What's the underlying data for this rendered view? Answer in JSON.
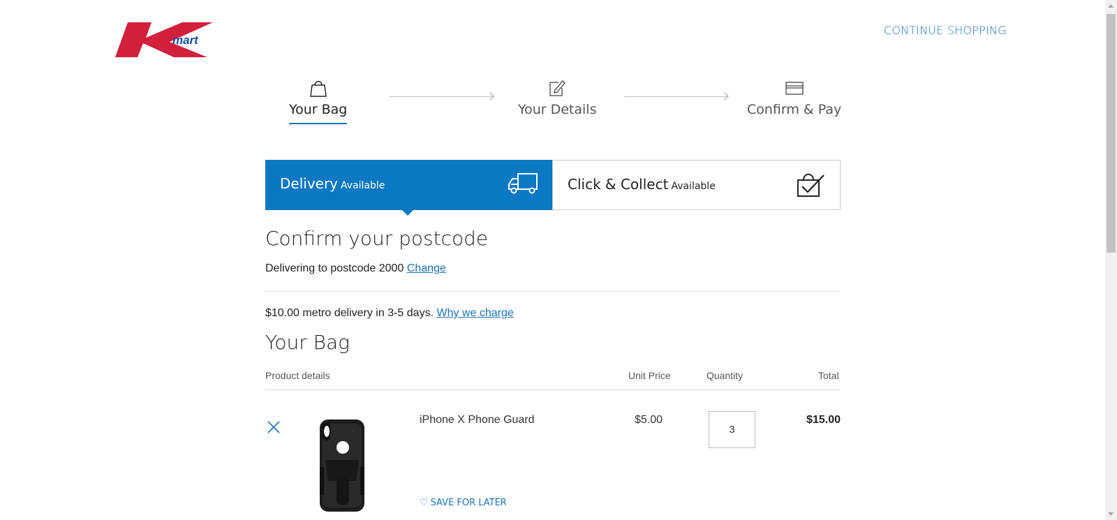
{
  "header": {
    "logo_text": "Kmart",
    "continue_label": "CONTINUE SHOPPING"
  },
  "steps": [
    {
      "label": "Your Bag",
      "icon": "bag-icon",
      "active": true
    },
    {
      "label": "Your Details",
      "icon": "edit-icon",
      "active": false
    },
    {
      "label": "Confirm & Pay",
      "icon": "card-icon",
      "active": false
    }
  ],
  "tabs": {
    "delivery": {
      "title": "Delivery",
      "status": "Available"
    },
    "collect": {
      "title": "Click & Collect",
      "status": "Available"
    }
  },
  "postcode": {
    "heading": "Confirm your postcode",
    "text": "Delivering to postcode 2000",
    "change_label": "Change"
  },
  "metro": {
    "text": "$10.00 metro delivery in 3-5 days.",
    "link": "Why we charge"
  },
  "bag": {
    "heading": "Your Bag",
    "columns": {
      "product": "Product details",
      "unit": "Unit Price",
      "qty": "Quantity",
      "total": "Total"
    },
    "items": [
      {
        "name": "iPhone X Phone Guard",
        "unit_price": "$5.00",
        "quantity": "3",
        "total": "$15.00",
        "save_label": "SAVE FOR LATER"
      }
    ]
  },
  "colors": {
    "brand_red": "#d21f3c",
    "accent_blue": "#0a78c2",
    "link_blue": "#1a73b8"
  }
}
